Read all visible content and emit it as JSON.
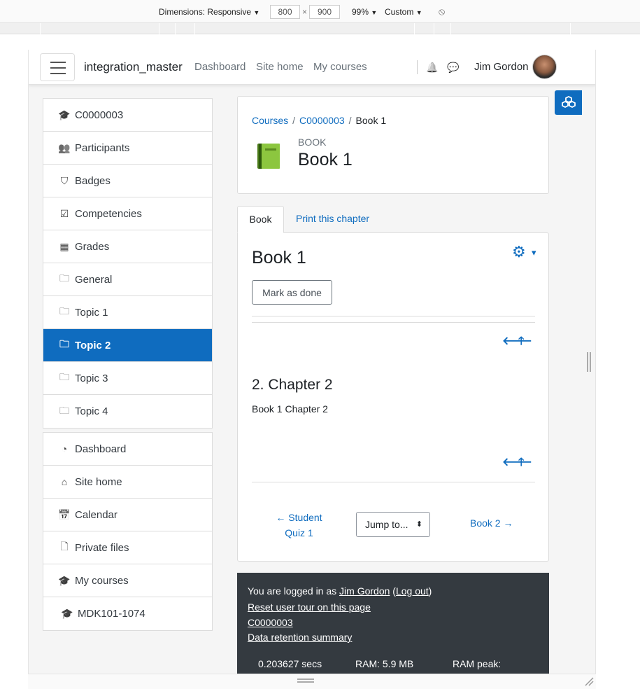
{
  "devtools": {
    "dimensions_label": "Dimensions: Responsive",
    "width_value": "800",
    "times": "×",
    "height_value": "900",
    "zoom": "99%",
    "throttle": "Custom",
    "dropdown_glyph": "▼",
    "rotate_glyph": "⦸"
  },
  "navbar": {
    "site_name": "integration_master",
    "links": [
      "Dashboard",
      "Site home",
      "My courses"
    ],
    "user_name": "Jim Gordon",
    "bell_glyph": "🔔",
    "chat_glyph": "💬"
  },
  "sidebar": {
    "course_items": [
      {
        "label": "C0000003",
        "icon": "graduation-cap-icon",
        "glyph": "🎓"
      },
      {
        "label": "Participants",
        "icon": "users-icon",
        "glyph": "👥"
      },
      {
        "label": "Badges",
        "icon": "shield-icon",
        "glyph": "⛉"
      },
      {
        "label": "Competencies",
        "icon": "check-square-icon",
        "glyph": "☑"
      },
      {
        "label": "Grades",
        "icon": "table-icon",
        "glyph": "▦"
      },
      {
        "label": "General",
        "icon": "folder-icon",
        "glyph": "🗀"
      },
      {
        "label": "Topic 1",
        "icon": "folder-icon",
        "glyph": "🗀"
      },
      {
        "label": "Topic 2",
        "icon": "folder-icon",
        "glyph": "🗀"
      },
      {
        "label": "Topic 3",
        "icon": "folder-icon",
        "glyph": "🗀"
      },
      {
        "label": "Topic 4",
        "icon": "folder-icon",
        "glyph": "🗀"
      }
    ],
    "site_items": [
      {
        "label": "Dashboard",
        "icon": "tachometer-icon",
        "glyph": "◔"
      },
      {
        "label": "Site home",
        "icon": "home-icon",
        "glyph": "⌂"
      },
      {
        "label": "Calendar",
        "icon": "calendar-icon",
        "glyph": "📅"
      },
      {
        "label": "Private files",
        "icon": "file-icon",
        "glyph": "🗋"
      },
      {
        "label": "My courses",
        "icon": "graduation-cap-icon",
        "glyph": "🎓"
      },
      {
        "label": "MDK101-1074",
        "icon": "graduation-cap-icon",
        "glyph": "🎓"
      }
    ]
  },
  "header": {
    "breadcrumb": [
      "Courses",
      "C0000003",
      "Book 1"
    ],
    "breadcrumb_sep": "/",
    "module_type": "BOOK",
    "title": "Book 1"
  },
  "tabs": [
    "Book",
    "Print this chapter"
  ],
  "content": {
    "heading": "Book 1",
    "mark_done": "Mark as done",
    "chapter_title": "2. Chapter 2",
    "chapter_text": "Book 1 Chapter 2",
    "prev_glyph": "🡐",
    "up_glyph": "🡑",
    "gear_glyph": "⚙",
    "caret_glyph": "▾"
  },
  "activity_nav": {
    "prev_line1": "← Student",
    "prev_line2": "Quiz 1",
    "jump": "Jump to...",
    "jump_glyph": "⬍",
    "next": "Book 2 →"
  },
  "footer": {
    "logged_prefix": "You are logged in as ",
    "user": "Jim Gordon",
    "logout_open": " (",
    "logout": "Log out",
    "logout_close": ")",
    "links": [
      "Reset user tour on this page",
      "C0000003",
      "Data retention summary"
    ],
    "perf": [
      "0.203627 secs",
      "RAM: 5.9 MB",
      "RAM peak:"
    ]
  },
  "colors": {
    "accent": "#0f6cbf",
    "footer_bg": "#343a40"
  }
}
